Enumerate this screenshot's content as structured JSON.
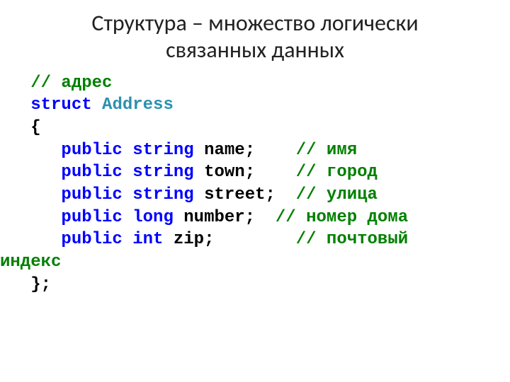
{
  "title_line1": "Структура – множество логически",
  "title_line2": "связанных данных",
  "code": {
    "indent1": "   ",
    "indent2": "      ",
    "c_addr": "// адрес",
    "kw_struct": "struct",
    "type_address": "Address",
    "brace_open": "{",
    "kw_public": "public",
    "kw_string": "string",
    "kw_long": "long",
    "kw_int": "int",
    "field_name": "name;",
    "field_town": "town;",
    "field_street": "street;",
    "field_number": "number;",
    "field_zip": "zip;",
    "pad_name": "    ",
    "pad_town": "    ",
    "pad_street": "  ",
    "pad_number": "  ",
    "pad_zip": "        ",
    "c_name": "// имя",
    "c_town": "// город",
    "c_street": "// улица",
    "c_number": "// номер дома",
    "c_zip": "// почтовый",
    "c_zip2": "индекс",
    "brace_close": "};"
  }
}
